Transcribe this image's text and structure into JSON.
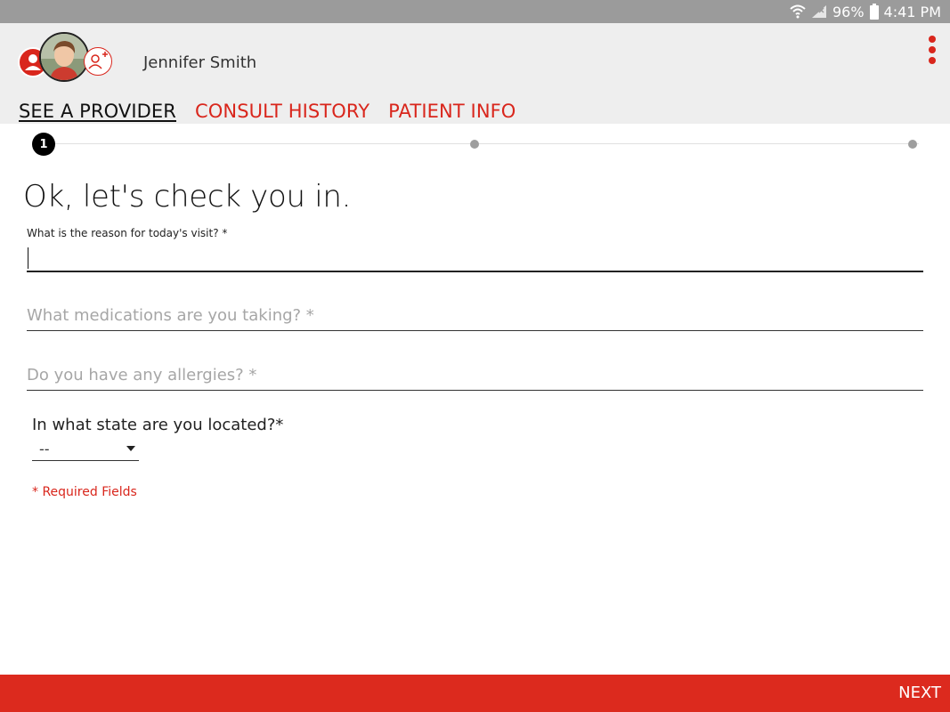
{
  "status_bar": {
    "battery_percent": "96%",
    "time": "4:41 PM",
    "icons": [
      "wifi-icon",
      "signal-icon",
      "battery-icon"
    ]
  },
  "header": {
    "user_name": "Jennifer Smith",
    "icons": [
      "user-profile-icon",
      "avatar-photo",
      "add-user-icon",
      "overflow-menu-icon"
    ],
    "accent_color": "#d9261c"
  },
  "tabs": [
    {
      "label": "SEE A PROVIDER",
      "active": true
    },
    {
      "label": "CONSULT HISTORY",
      "active": false
    },
    {
      "label": "PATIENT INFO",
      "active": false
    }
  ],
  "stepper": {
    "current_step": "1",
    "total_steps": 3
  },
  "form": {
    "heading": "Ok, let's check you in.",
    "reason_label": "What is the reason for today's visit? *",
    "reason_value": "",
    "medications_placeholder": "What medications are you taking? *",
    "allergies_placeholder": "Do you have any allergies? *",
    "state_label": "In what state are you located?*",
    "state_selected": "--",
    "required_note": "* Required Fields"
  },
  "footer": {
    "next_label": "NEXT",
    "bar_color": "#dc2a1e"
  }
}
